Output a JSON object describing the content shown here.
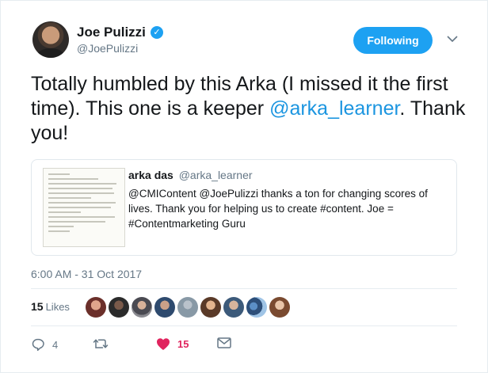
{
  "author": {
    "name": "Joe Pulizzi",
    "handle": "@JoePulizzi",
    "verified_glyph": "✓",
    "avatar_icon": "profile-avatar"
  },
  "follow_button": {
    "label": "Following"
  },
  "tweet": {
    "text_before": "Totally humbled by this Arka (I missed it the first time). This one is a keeper ",
    "mention": "@arka_learner",
    "text_after": ". Thank you!"
  },
  "quoted_tweet": {
    "name": "arka das",
    "handle": "@arka_learner",
    "text": "@CMIContent @JoePulizzi thanks a ton for changing scores of lives. Thank you for helping us to create #content. Joe = #Contentmarketing Guru"
  },
  "timestamp": "6:00 AM - 31 Oct 2017",
  "likes": {
    "count": "15",
    "label": "Likes"
  },
  "actions": {
    "reply_count": "4",
    "retweet_count": "",
    "like_count": "15"
  },
  "colors": {
    "brand_blue": "#1da1f2",
    "mention_blue": "#1b95e0",
    "like_red": "#e0245e",
    "muted_gray": "#657786"
  }
}
